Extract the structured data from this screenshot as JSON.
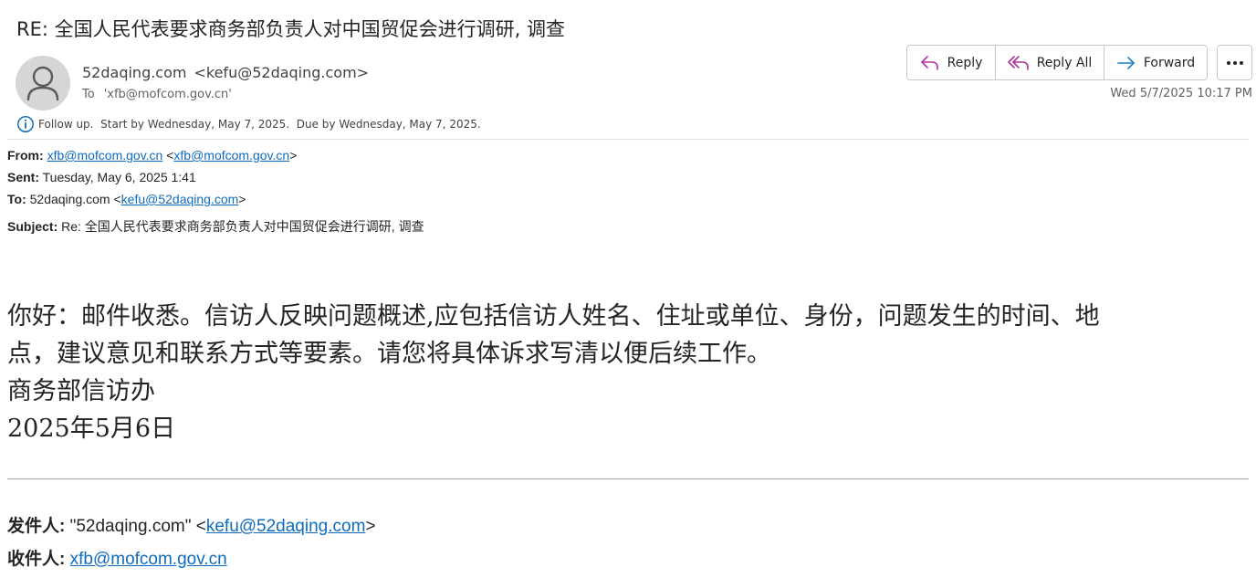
{
  "message": {
    "subject": "RE: 全国人民代表要求商务部负责人对中国贸促会进行调研, 调查",
    "sender_name": "52daqing.com",
    "sender_email": "<kefu@52daqing.com>",
    "to_label": "To",
    "to_value": "'xfb@mofcom.gov.cn'",
    "date": "Wed 5/7/2025 10:17 PM",
    "followup": "Follow up.  Start by Wednesday, May 7, 2025.  Due by Wednesday, May 7, 2025."
  },
  "actions": {
    "reply": "Reply",
    "reply_all": "Reply All",
    "forward": "Forward"
  },
  "quoted_header": {
    "from_label": "From:",
    "from_link1": "xfb@mofcom.gov.cn",
    "from_link2": "xfb@mofcom.gov.cn",
    "sent_label": "Sent:",
    "sent_value": "Tuesday, May 6, 2025 1:41",
    "to_label": "To:",
    "to_name": "52daqing.com",
    "to_link": "kefu@52daqing.com",
    "subject_label": "Subject:",
    "subject_value": "Re: 全国人民代表要求商务部负责人对中国贸促会进行调研, 调查"
  },
  "body": {
    "line1": "你好：邮件收悉。信访人反映问题概述,应包括信访人姓名、住址或单位、身份，问题发生的时间、地",
    "line2": "点，建议意见和联系方式等要素。请您将具体诉求写清以便后续工作。",
    "line3": "商务部信访办",
    "line4": "2025年5月6日"
  },
  "footer": {
    "sender_label": "发件人:",
    "sender_name": "\"52daqing.com\"",
    "sender_link": "kefu@52daqing.com",
    "recipient_label": "收件人:",
    "recipient_link": "xfb@mofcom.gov.cn"
  },
  "colors": {
    "link": "#0f6cbd",
    "reply_icon": "#b4329c",
    "forward_icon": "#1f7fc1",
    "info_icon": "#0f6cbd"
  }
}
